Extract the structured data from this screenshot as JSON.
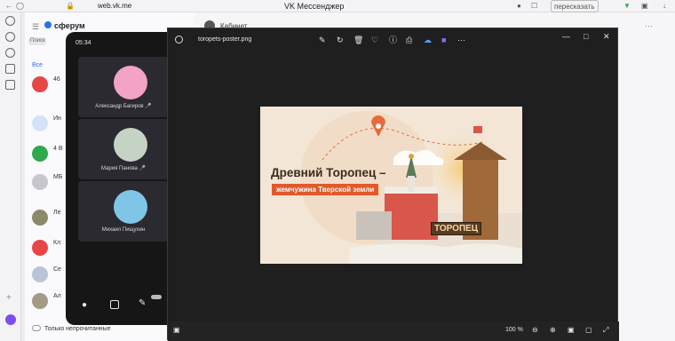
{
  "browser": {
    "url": "web.vk.me",
    "tab_title": "VK Мессенджер",
    "retell_label": "пересказать"
  },
  "vk": {
    "brand": "сферум",
    "header_peek": "Кабинет",
    "search_peek": "Поиск",
    "filter_peek": "Все",
    "unread_label": "Только непрочитанные",
    "rows": [
      {
        "t": "46"
      },
      {
        "t": "Ин"
      },
      {
        "t": "4 В"
      },
      {
        "t": "МБ"
      },
      {
        "t": "Ле"
      },
      {
        "t": "Кл"
      },
      {
        "t": "Се"
      },
      {
        "t": "Ал"
      }
    ]
  },
  "call": {
    "time": "05:34",
    "participants": [
      {
        "name": "Александр Багиров"
      },
      {
        "name": "Мария Панова"
      },
      {
        "name": "Михаил Пищухин"
      }
    ]
  },
  "viewer": {
    "filename": "toropets-poster.png",
    "zoom": "100 %"
  },
  "poster": {
    "title": "Древний Торопец –",
    "subtitle": "жемчужина Тверской земли",
    "sign": "ТОРОПЕЦ"
  }
}
